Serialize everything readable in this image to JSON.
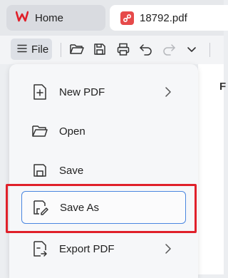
{
  "tabs": {
    "home_label": "Home",
    "doc_label": "18792.pdf"
  },
  "toolbar": {
    "file_label": "File",
    "icons": [
      "open-folder-icon",
      "save-icon",
      "print-icon",
      "undo-icon",
      "redo-icon",
      "chevron-down-icon"
    ]
  },
  "content": {
    "peek_text": "F"
  },
  "file_menu": {
    "items": [
      {
        "label": "New PDF",
        "icon": "new-file-icon",
        "has_submenu": true
      },
      {
        "label": "Open",
        "icon": "folder-icon",
        "has_submenu": false
      },
      {
        "label": "Save",
        "icon": "save-icon",
        "has_submenu": false
      },
      {
        "label": "Save As",
        "icon": "save-as-icon",
        "has_submenu": false,
        "selected": true
      },
      {
        "label": "Export PDF",
        "icon": "export-icon",
        "has_submenu": true
      }
    ]
  },
  "colors": {
    "accent": "#4a86e0",
    "highlight": "#e0202a",
    "brand_red": "#e64a4a"
  }
}
